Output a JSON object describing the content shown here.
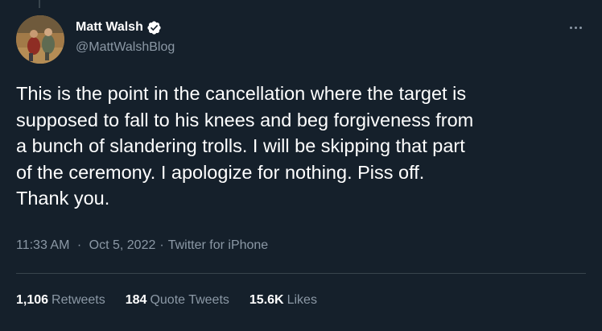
{
  "author": {
    "display_name": "Matt Walsh",
    "handle": "@MattWalshBlog",
    "verified_icon": "verified-badge-icon",
    "verified_color": "#ffffff"
  },
  "tweet": {
    "text": "This is the point in the cancellation where the target is\nsupposed to fall to his knees and beg forgiveness from\na bunch of slandering trolls. I will be skipping that part\nof the ceremony. I apologize for nothing. Piss off.\nThank you.",
    "time": "11:33 AM",
    "separator": "·",
    "date": "Oct 5, 2022",
    "source": "Twitter for iPhone"
  },
  "stats": {
    "retweets": {
      "count": "1,106",
      "label": "Retweets"
    },
    "quotes": {
      "count": "184",
      "label": "Quote Tweets"
    },
    "likes": {
      "count": "15.6K",
      "label": "Likes"
    }
  },
  "colors": {
    "background": "#15202b",
    "primary_text": "#ffffff",
    "secondary_text": "#8b98a5",
    "border": "#38444d"
  },
  "icons": {
    "more": "more-options-icon"
  }
}
